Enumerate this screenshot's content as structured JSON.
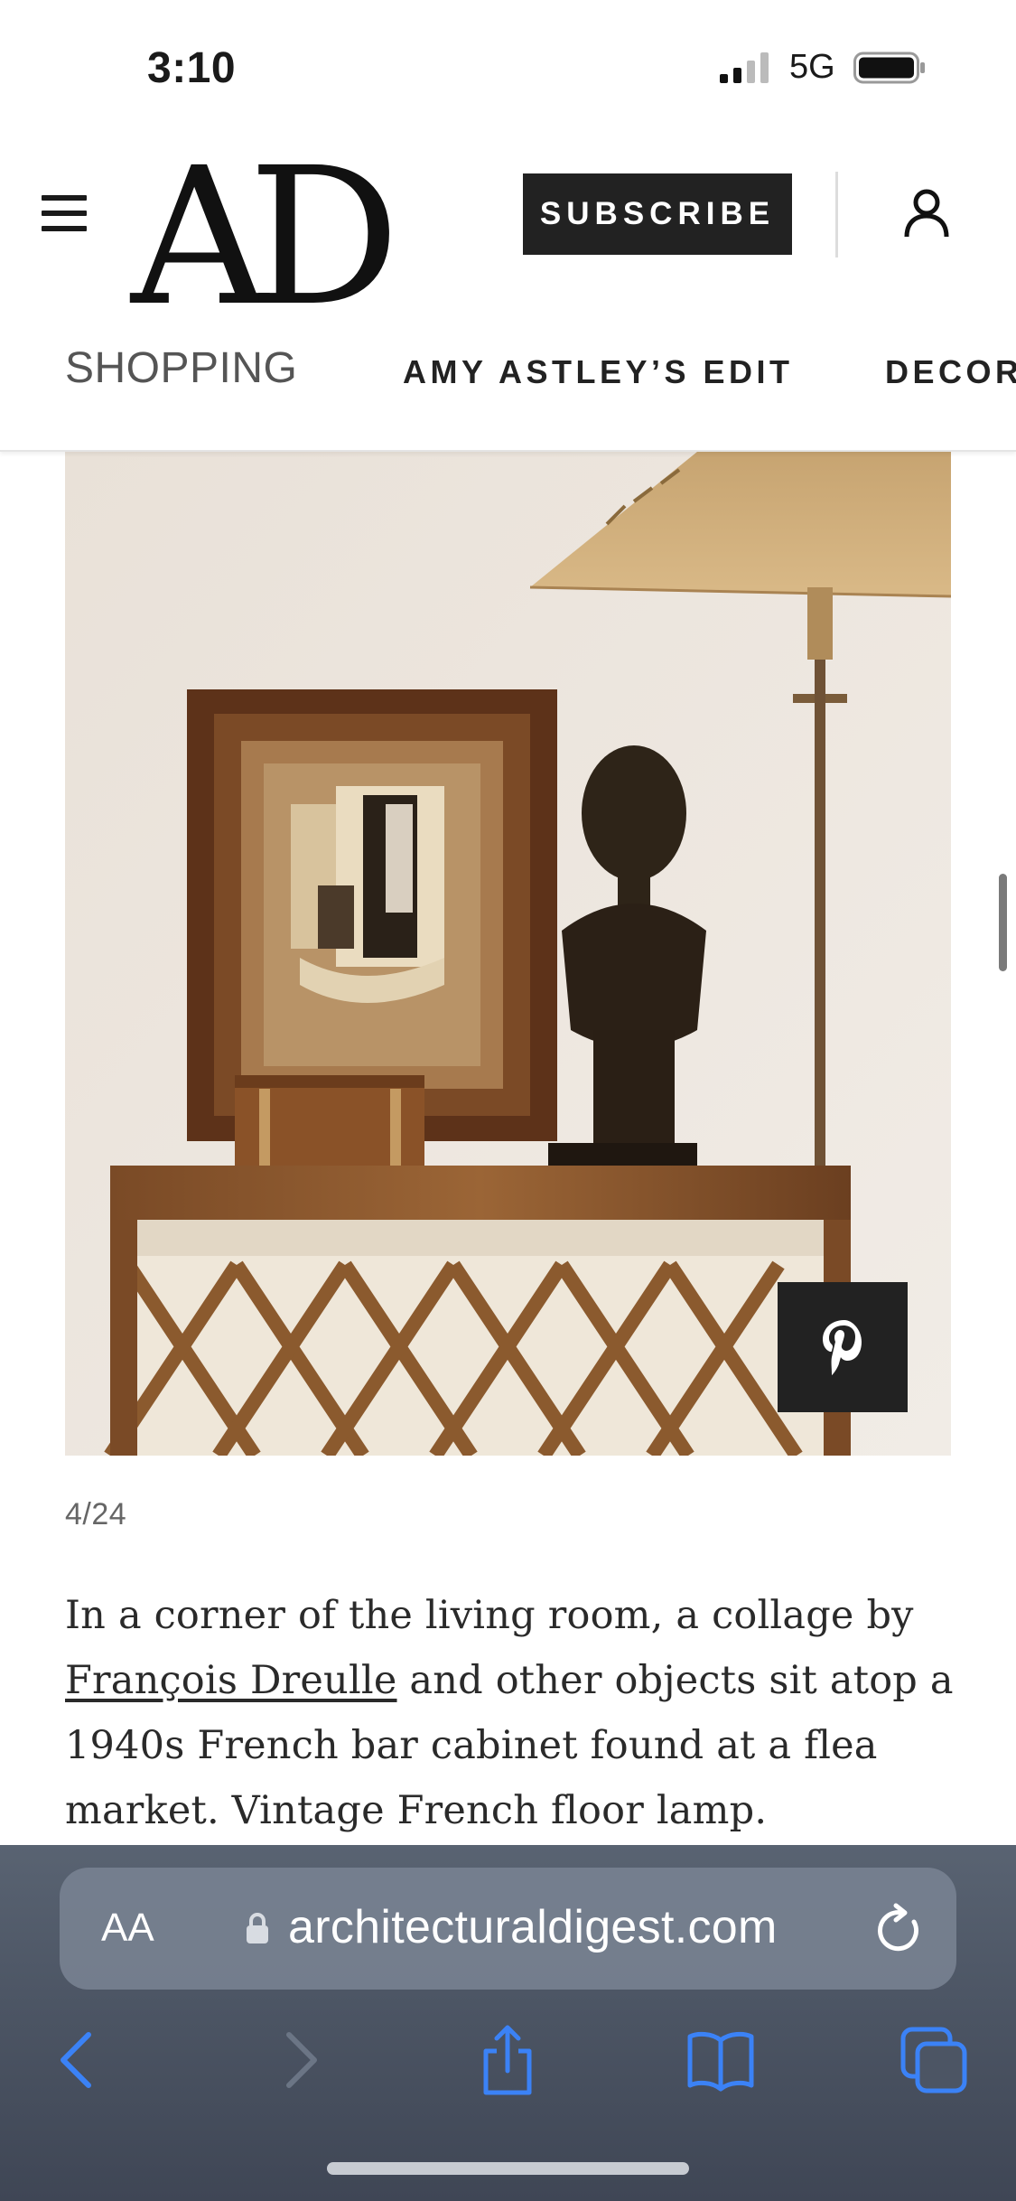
{
  "status_bar": {
    "time": "3:10",
    "network": "5G"
  },
  "header": {
    "logo": "AD",
    "subscribe_label": "SUBSCRIBE",
    "icons": [
      "menu-icon",
      "account-icon"
    ]
  },
  "category_nav": {
    "items": [
      "SHOPPING",
      "AMY ASTLEY’S EDIT",
      "DECOR"
    ]
  },
  "gallery": {
    "slide_counter": "4/24",
    "pin_icon": "pinterest-icon"
  },
  "caption": {
    "text_before": "In a corner of the living room, a collage by ",
    "link_text": "François Dreulle",
    "text_after": " and other objects sit atop a 1940s French bar cabinet found at a flea market. Vintage French floor lamp."
  },
  "browser": {
    "text_size_label": "AA",
    "url": "architecturaldigest.com",
    "toolbar_icons": [
      "back-icon",
      "forward-icon",
      "share-icon",
      "bookmarks-icon",
      "tabs-icon"
    ]
  },
  "colors": {
    "browser_accent": "#3b82f6",
    "dark_button": "#222222"
  }
}
